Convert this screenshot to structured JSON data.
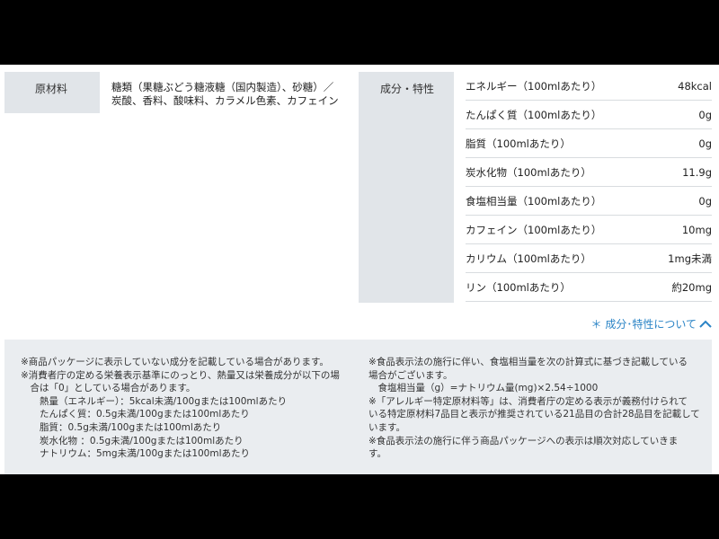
{
  "ingredients": {
    "label": "原材料",
    "lines": [
      "糖類（果糖ぶどう糖液糖（国内製造）、砂糖）／",
      "炭酸、香料、酸味料、カラメル色素、カフェイン"
    ]
  },
  "nutrition": {
    "label": "成分・特性",
    "rows": [
      {
        "name": "エネルギー（100mlあたり）",
        "value": "48kcal"
      },
      {
        "name": "たんぱく質（100mlあたり）",
        "value": "0g"
      },
      {
        "name": "脂質（100mlあたり）",
        "value": "0g"
      },
      {
        "name": "炭水化物（100mlあたり）",
        "value": "11.9g"
      },
      {
        "name": "食塩相当量（100mlあたり）",
        "value": "0g"
      },
      {
        "name": "カフェイン（100mlあたり）",
        "value": "10mg"
      },
      {
        "name": "カリウム（100mlあたり）",
        "value": "1mg未満"
      },
      {
        "name": "リン（100mlあたり）",
        "value": "約20mg"
      }
    ]
  },
  "more_link": {
    "text": "＊ 成分･特性について",
    "icon": "chevron-up-icon",
    "color": "#2b84c6"
  },
  "notes": {
    "left_lines": [
      "※商品パッケージに表示していない成分を記載している場合があります。",
      "※消費者庁の定める栄養表示基準にのっとり、熱量又は栄養成分が以下の場",
      "　合は「0」としている場合があります。",
      "　　熱量（エネルギー）：5kcal未満/100gまたは100mlあたり",
      "　　たんぱく質：0.5g未満/100gまたは100mlあたり",
      "　　脂質：0.5g未満/100gまたは100mlあたり",
      "　　炭水化物 ：0.5g未満/100gまたは100mlあたり",
      "　　ナトリウム：5mg未満/100gまたは100mlあたり"
    ],
    "right_lines": [
      "※食品表示法の施行に伴い、食塩相当量を次の計算式に基づき記載している",
      "場合がございます。",
      "　食塩相当量（g）=ナトリウム量(mg)×2.54÷1000",
      "※「アレルギー特定原材料等」は、消費者庁の定める表示が義務付けられて",
      "いる特定原材料7品目と表示が推奨されている21品目の合計28品目を記載して",
      "います。",
      "※食品表示法の施行に伴う商品パッケージへの表示は順次対応していきま",
      "す。"
    ]
  }
}
